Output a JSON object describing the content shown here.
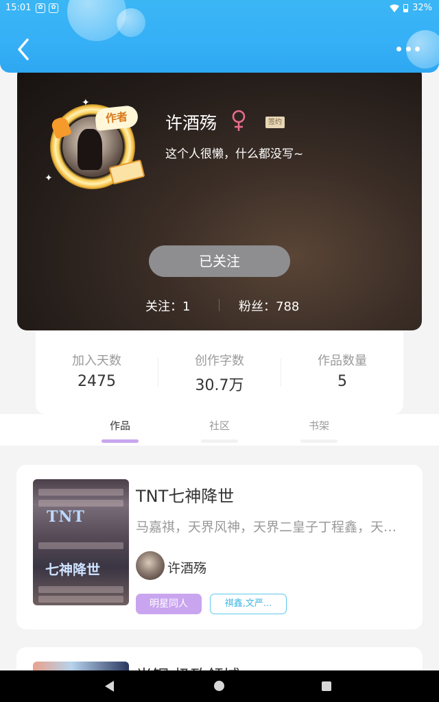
{
  "status_bar": {
    "time": "15:01",
    "battery": "32%",
    "icons": [
      "paw-app-icon",
      "paw-app-icon",
      "wifi-icon",
      "battery-icon"
    ]
  },
  "header": {
    "back_icon": "back-chevron-icon",
    "more_icon": "more-dots-icon"
  },
  "profile": {
    "avatar_badge": "作者",
    "name": "许酒殇",
    "gender_icon": "female-icon",
    "sign_label": "签约",
    "bio": "这个人很懒，什么都没写~",
    "follow_button": "已关注",
    "following_label": "关注：",
    "following_count": "1",
    "fans_label": "粉丝：",
    "fans_count": "788"
  },
  "stats": [
    {
      "label": "加入天数",
      "value": "2475"
    },
    {
      "label": "创作字数",
      "value": "30.7万"
    },
    {
      "label": "作品数量",
      "value": "5"
    }
  ],
  "tabs": [
    {
      "label": "作品",
      "active": true
    },
    {
      "label": "社区",
      "active": false
    },
    {
      "label": "书架",
      "active": false
    }
  ],
  "books": [
    {
      "cover_title": "TNT",
      "cover_subtitle": "七神降世",
      "title": "TNT七神降世",
      "description": "马嘉祺，天界风神，天界二皇子丁程鑫，天界大皇子",
      "author": "许酒殇",
      "tags": [
        "明星同人",
        "祺鑫,文严..."
      ]
    },
    {
      "title": "光钢·极致领域"
    }
  ],
  "colors": {
    "header_blue": "#36b0f6",
    "tab_active": "#c9a6ef",
    "tag_purple": "#c9a5ef",
    "tag_blue": "#3eb6e6"
  }
}
